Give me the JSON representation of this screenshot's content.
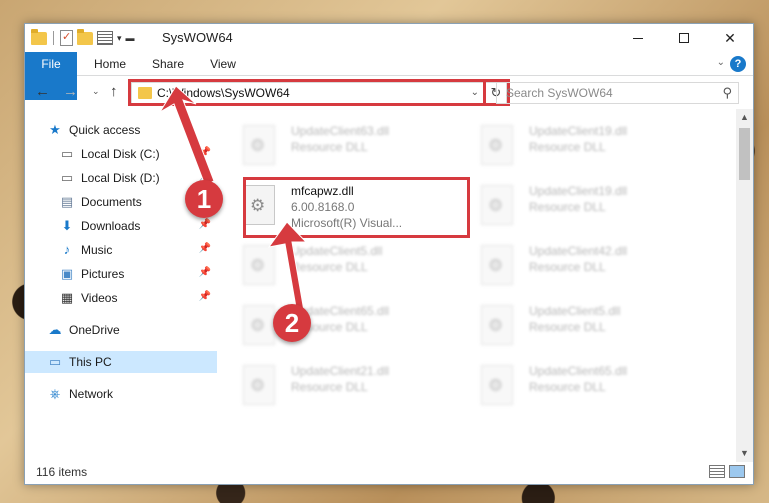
{
  "window": {
    "title": "SysWOW64"
  },
  "ribbon": {
    "tabs": [
      "File",
      "Home",
      "Share",
      "View"
    ]
  },
  "navbar": {
    "address": "C:\\Windows\\SysWOW64",
    "search_placeholder": "Search SysWOW64"
  },
  "sidebar": {
    "items": [
      {
        "label": "Quick access",
        "icon": "star-icon"
      },
      {
        "label": "Local Disk (C:)",
        "icon": "drive-icon",
        "pinned": true
      },
      {
        "label": "Local Disk (D:)",
        "icon": "drive-icon",
        "pinned": true
      },
      {
        "label": "Documents",
        "icon": "documents-icon",
        "pinned": true
      },
      {
        "label": "Downloads",
        "icon": "downloads-icon",
        "pinned": true
      },
      {
        "label": "Music",
        "icon": "music-icon",
        "pinned": true
      },
      {
        "label": "Pictures",
        "icon": "pictures-icon",
        "pinned": true
      },
      {
        "label": "Videos",
        "icon": "videos-icon",
        "pinned": true
      },
      {
        "label": "OneDrive",
        "icon": "cloud-icon"
      },
      {
        "label": "This PC",
        "icon": "computer-icon",
        "selected": true
      },
      {
        "label": "Network",
        "icon": "network-icon"
      }
    ]
  },
  "files": {
    "highlighted": {
      "name": "mfcapwz.dll",
      "version": "6.00.8168.0",
      "description": "Microsoft(R) Visual..."
    },
    "blurred": [
      {
        "name": "UpdateClient63.dll",
        "desc": "Resource DLL"
      },
      {
        "name": "UpdateClient19.dll",
        "desc": "Resource DLL"
      },
      {
        "name": "UpdateClient19.dll",
        "desc": "Resource DLL"
      },
      {
        "name": "UpdateClient5.dll",
        "desc": "Resource DLL"
      },
      {
        "name": "UpdateClient42.dll",
        "desc": "Resource DLL"
      },
      {
        "name": "UpdateClient65.dll",
        "desc": "Resource DLL"
      },
      {
        "name": "UpdateClient5.dll",
        "desc": "Resource DLL"
      },
      {
        "name": "UpdateClient21.dll",
        "desc": "Resource DLL"
      },
      {
        "name": "UpdateClient65.dll",
        "desc": "Resource DLL"
      }
    ]
  },
  "status": {
    "item_count": "116 items"
  },
  "callouts": [
    "1",
    "2"
  ],
  "colors": {
    "accent": "#1979ca",
    "highlight": "#d63a3f",
    "selected": "#cce8ff"
  }
}
